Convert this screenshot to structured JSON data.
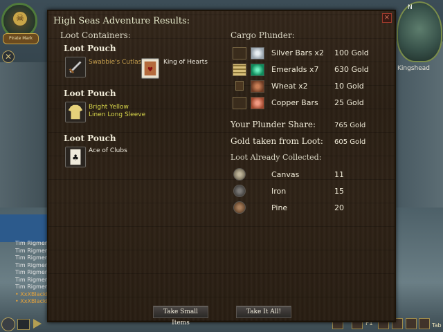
{
  "dialog": {
    "title": "High Seas Adventure Results:",
    "close_label": "×"
  },
  "loot": {
    "header": "Loot Containers:",
    "pouches": [
      {
        "title": "Loot Pouch",
        "items": [
          {
            "label": "Swabbie's Cutlass",
            "icon": "cutlass-icon",
            "color": "#c9a24f"
          },
          {
            "label": "King of Hearts",
            "icon": "king-of-hearts-card-icon",
            "color": "#f0ece0"
          }
        ]
      },
      {
        "title": "Loot Pouch",
        "items": [
          {
            "label": "Bright Yellow",
            "label2": "Linen Long Sleeve",
            "icon": "shirt-icon",
            "color": "#d8d64a"
          }
        ]
      },
      {
        "title": "Loot Pouch",
        "items": [
          {
            "label": "Ace of Clubs",
            "icon": "ace-of-clubs-card-icon",
            "color": "#f0ece0"
          }
        ]
      }
    ]
  },
  "cargo": {
    "header": "Cargo Plunder:",
    "rows": [
      {
        "name": "Silver Bars x2",
        "value": "100 Gold",
        "icon": "silver-bars-icon"
      },
      {
        "name": "Emeralds x7",
        "value": "630 Gold",
        "icon": "emeralds-icon"
      },
      {
        "name": "Wheat x2",
        "value": "10 Gold",
        "icon": "wheat-icon"
      },
      {
        "name": "Copper Bars",
        "value": "25 Gold",
        "icon": "copper-bars-icon"
      }
    ]
  },
  "summary": {
    "share_label": "Your Plunder Share:",
    "share_value": "765 Gold",
    "loot_gold_label": "Gold taken from Loot:",
    "loot_gold_value": "605 Gold"
  },
  "collected": {
    "header": "Loot Already Collected:",
    "rows": [
      {
        "name": "Canvas",
        "value": "11",
        "icon": "canvas-icon"
      },
      {
        "name": "Iron",
        "value": "15",
        "icon": "iron-icon"
      },
      {
        "name": "Pine",
        "value": "20",
        "icon": "pine-icon"
      }
    ]
  },
  "buttons": {
    "take_small": "Take Small Items",
    "take_all": "Take It All!"
  },
  "hud": {
    "flag_label": "Pirate Mark",
    "compass_north": "N",
    "location": "Kingshead",
    "chat_lines": [
      {
        "text": "Tim Rigmena",
        "gold": false
      },
      {
        "text": "Tim Rigmena",
        "gold": false
      },
      {
        "text": "Tim Rigmena",
        "gold": false
      },
      {
        "text": "Tim Rigmena",
        "gold": false
      },
      {
        "text": "Tim Rigmena",
        "gold": false
      },
      {
        "text": "Tim Rigmena",
        "gold": false
      },
      {
        "text": "Tim Rigmena",
        "gold": false
      },
      {
        "text": "• XxXBlackbe",
        "gold": true
      },
      {
        "text": "• XxXBlackbe",
        "gold": true
      }
    ],
    "hotkey_f1": "F1",
    "hotkey_tab": "Tab"
  }
}
